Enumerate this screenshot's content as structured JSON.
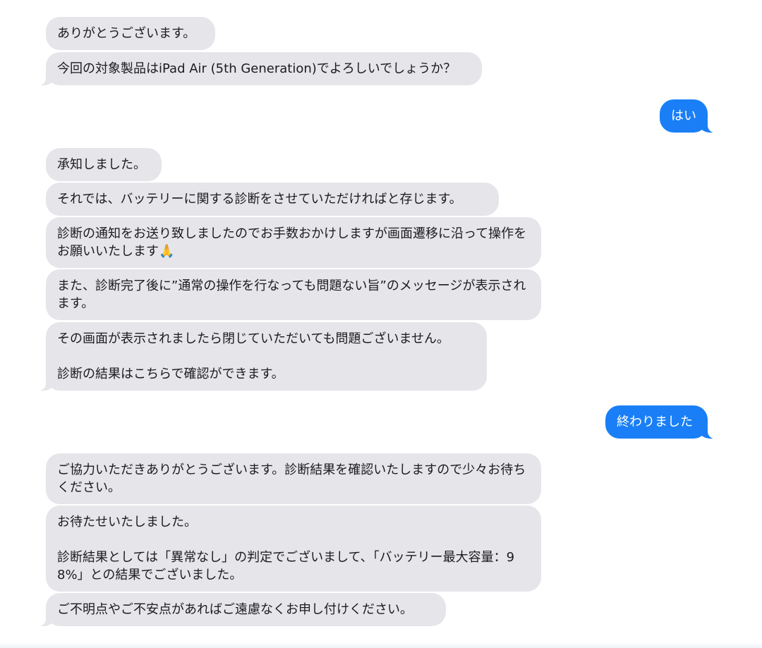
{
  "messages": [
    {
      "side": "in",
      "text": "ありがとうございます。"
    },
    {
      "side": "in",
      "text": "今回の対象製品はiPad Air (5th Generation)でよろしいでしょうか？"
    },
    {
      "side": "out",
      "text": "はい"
    },
    {
      "side": "in",
      "text": "承知しました。"
    },
    {
      "side": "in",
      "text": "それでは、バッテリーに関する診断をさせていただければと存じます。"
    },
    {
      "side": "in",
      "text": "診断の通知をお送り致しましたのでお手数おかけしますが画面遷移に沿って操作をお願いいたします🙏"
    },
    {
      "side": "in",
      "text": "また、診断完了後に”通常の操作を行なっても問題ない旨”のメッセージが表示されます。"
    },
    {
      "side": "in",
      "text": "その画面が表示されましたら閉じていただいても問題ございません。\n\n診断の結果はこちらで確認ができます。"
    },
    {
      "side": "out",
      "text": "終わりました"
    },
    {
      "side": "in",
      "text": "ご協力いただきありがとうございます。診断結果を確認いたしますので少々お待ちください。"
    },
    {
      "side": "in",
      "text": "お待たせいたしました。\n\n診断結果としては「異常なし」の判定でございまして、「バッテリー最大容量：98%」との結果でございました。"
    },
    {
      "side": "in",
      "text": "ご不明点やご不安点があればご遠慮なくお申し付けください。"
    }
  ],
  "colors": {
    "incoming_bubble": "#e5e5ea",
    "outgoing_bubble": "#1a7ff6",
    "background": "#ffffff"
  }
}
